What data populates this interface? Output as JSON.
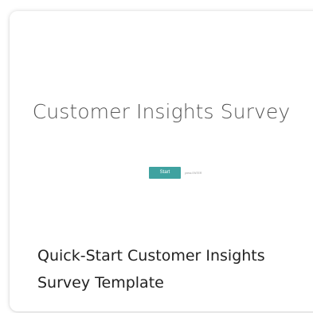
{
  "card": {
    "preview": {
      "survey_title": "Customer Insights Survey",
      "start_button_label": "Start",
      "start_hint": "press ENTER"
    },
    "template_name": "Quick-Start Customer Insights Survey Template"
  },
  "colors": {
    "start_button": "#3fa2a0",
    "survey_title_text": "#555555",
    "template_name_text": "#222222"
  }
}
